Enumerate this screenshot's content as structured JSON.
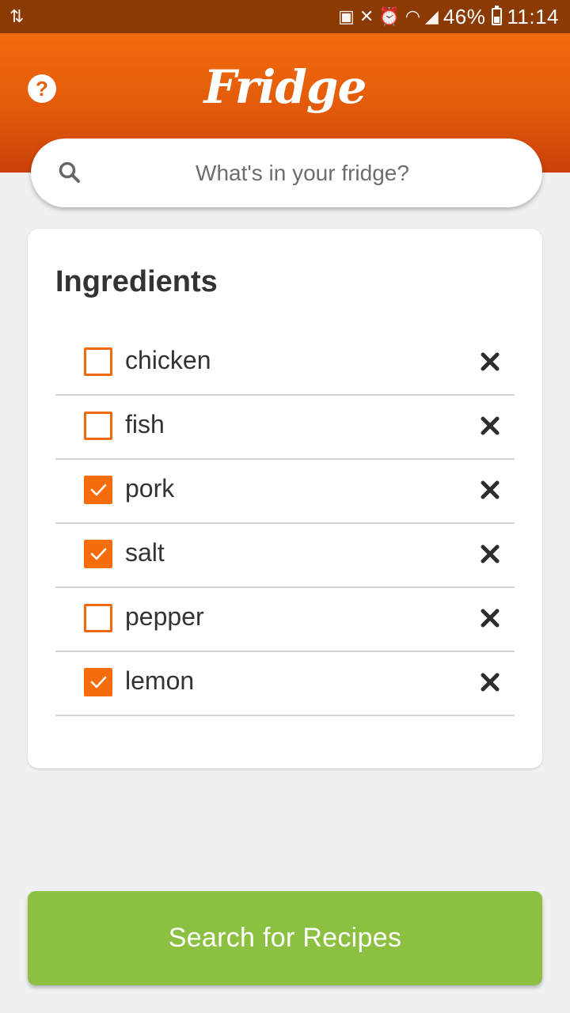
{
  "status_bar": {
    "left_icon": "usb-transfer-icon",
    "icons": [
      "calendar-icon",
      "vibrate-mute-icon",
      "alarm-icon",
      "wifi-icon",
      "signal-icon"
    ],
    "battery": "46%",
    "time": "11:14"
  },
  "header": {
    "title": "Fridge",
    "help_icon": "help-icon",
    "color": "#f26b0c"
  },
  "search": {
    "placeholder": "What's in your fridge?",
    "value": "",
    "icon": "search-icon"
  },
  "ingredients": {
    "title": "Ingredients",
    "items": [
      {
        "name": "chicken",
        "checked": false
      },
      {
        "name": "fish",
        "checked": false
      },
      {
        "name": "pork",
        "checked": true
      },
      {
        "name": "salt",
        "checked": true
      },
      {
        "name": "pepper",
        "checked": false
      },
      {
        "name": "lemon",
        "checked": true
      }
    ],
    "remove_icon": "close-icon",
    "accent": "#f56c0b"
  },
  "cta": {
    "label": "Search for Recipes",
    "color": "#8bc041"
  }
}
